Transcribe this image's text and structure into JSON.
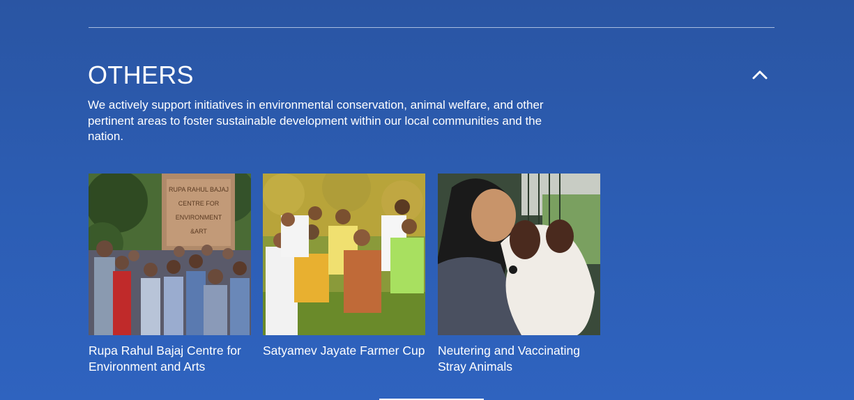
{
  "section": {
    "title": "OTHERS",
    "description": "We actively support initiatives in environmental conservation, animal welfare, and other pertinent areas to foster sustainable development within our local communities and the nation.",
    "toggle_icon": "chevron-up-icon"
  },
  "cards": [
    {
      "caption": "Rupa Rahul Bajaj Centre for Environment and Arts",
      "sign_lines": [
        "RUPA RAHUL BAJAJ",
        "CENTRE FOR",
        "ENVIRONMENT",
        "&ART"
      ]
    },
    {
      "caption": "Satyamev Jayate Farmer Cup"
    },
    {
      "caption": "Neutering and Vaccinating Stray Animals"
    }
  ],
  "colors": {
    "background": "#2c5db3",
    "text": "#ffffff",
    "divider": "#a9bde0"
  }
}
